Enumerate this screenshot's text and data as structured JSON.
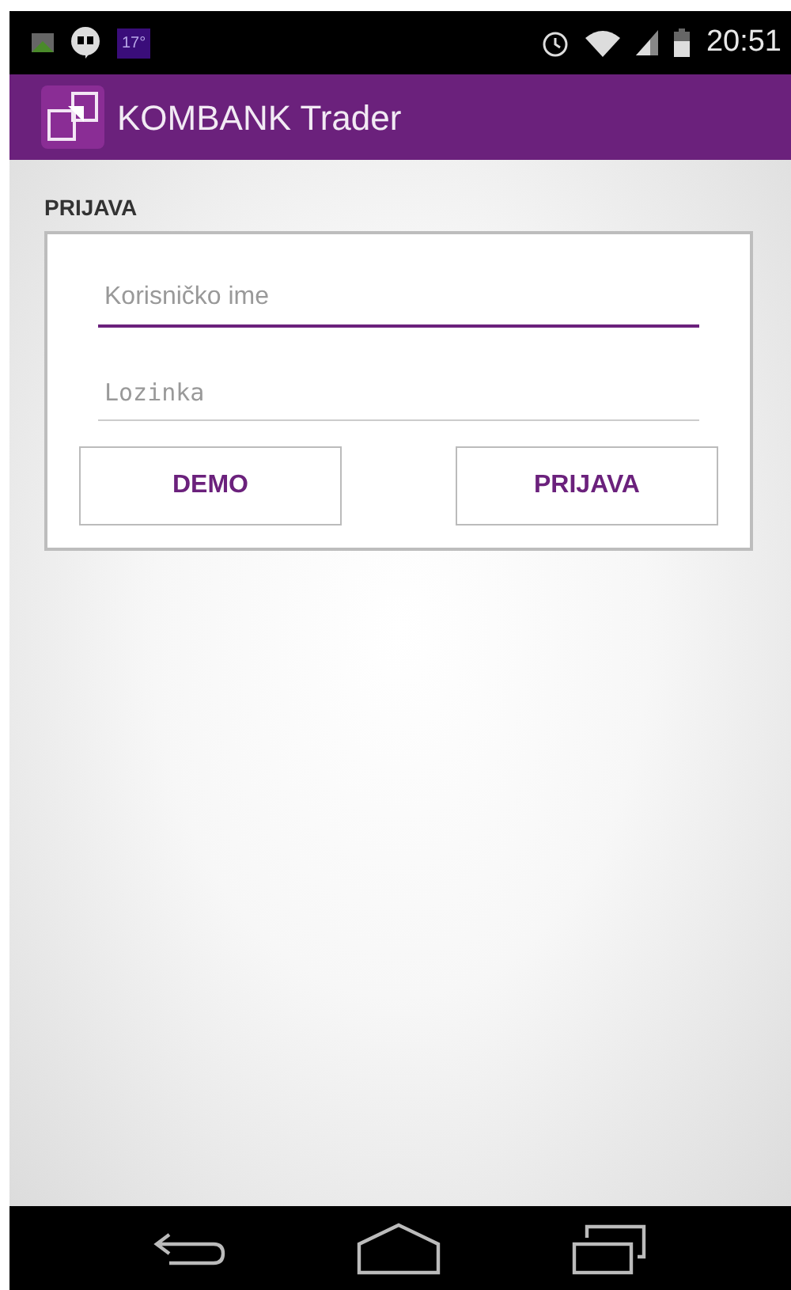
{
  "status_bar": {
    "weather": "17°",
    "time": "20:51"
  },
  "app_bar": {
    "title": "KOMBANK Trader"
  },
  "login": {
    "heading": "PRIJAVA",
    "fields": [
      {
        "placeholder": "Korisničko ime",
        "focused": true,
        "kind": "text"
      },
      {
        "placeholder": "Lozinka",
        "focused": false,
        "kind": "password"
      }
    ],
    "buttons": [
      "DEMO",
      "PRIJAVA"
    ]
  }
}
